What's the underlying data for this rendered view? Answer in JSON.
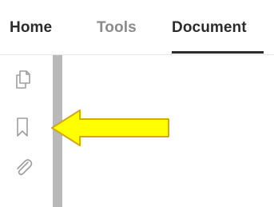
{
  "tabs": [
    {
      "label": "Home",
      "active": false
    },
    {
      "label": "Tools",
      "active": false
    },
    {
      "label": "Document",
      "active": true
    }
  ],
  "nav_pane": {
    "icons": [
      "page-thumbnails-icon",
      "bookmarks-icon",
      "attachments-icon"
    ]
  },
  "annotation": {
    "arrow_color": "#ffff00",
    "arrow_outline": "#d4a900"
  },
  "colors": {
    "active_tab_text": "#2c2c2c",
    "inactive_tab_text": "#8a8a8a",
    "splitter": "#b9b9b9",
    "icon": "#9e9e9e"
  }
}
